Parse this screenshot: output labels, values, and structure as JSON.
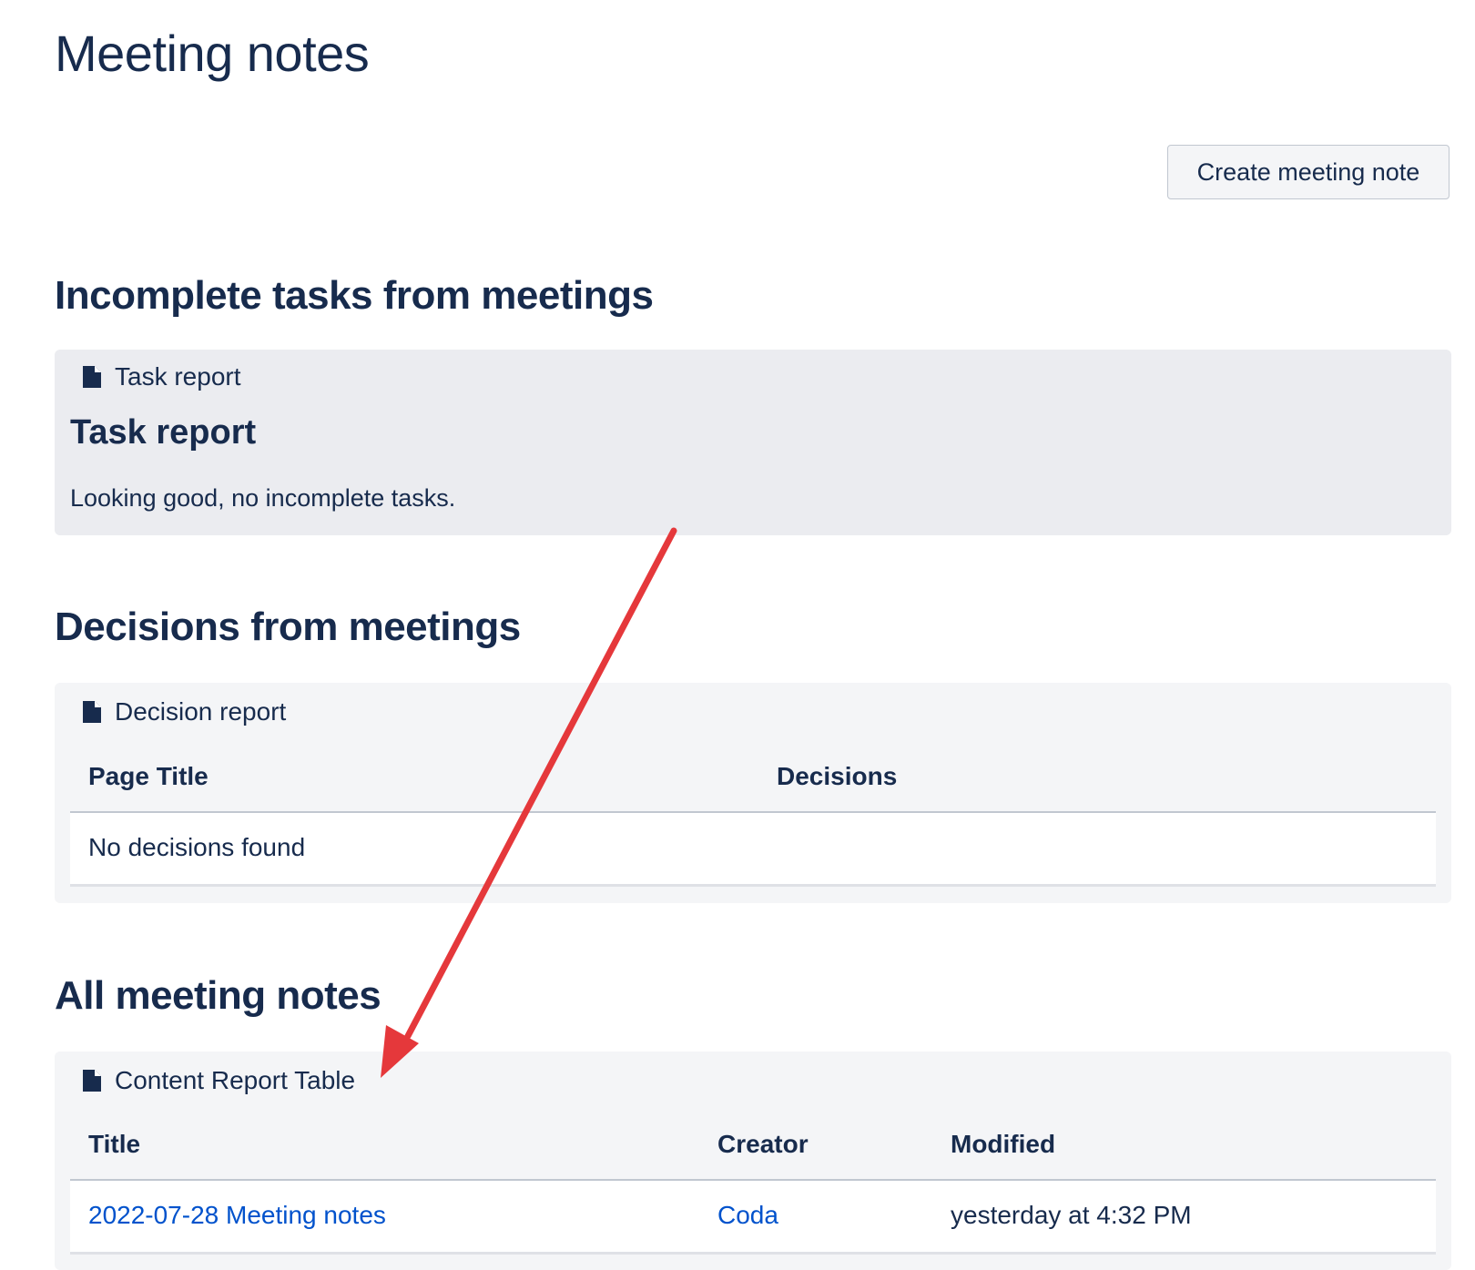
{
  "page": {
    "title": "Meeting notes",
    "create_button_label": "Create meeting note"
  },
  "sections": {
    "tasks": {
      "heading": "Incomplete tasks from meetings",
      "macro_label": "Task report",
      "report_title": "Task report",
      "message": "Looking good, no incomplete tasks."
    },
    "decisions": {
      "heading": "Decisions from meetings",
      "macro_label": "Decision report",
      "columns": [
        "Page Title",
        "Decisions"
      ],
      "empty_message": "No decisions found"
    },
    "all_notes": {
      "heading": "All meeting notes",
      "macro_label": "Content Report Table",
      "columns": [
        "Title",
        "Creator",
        "Modified"
      ],
      "rows": [
        {
          "title": "2022-07-28 Meeting notes",
          "creator": "Coda",
          "modified": "yesterday at 4:32 PM"
        }
      ]
    }
  },
  "annotation": {
    "arrow_color": "#e5383b",
    "icon": "red-arrow-icon"
  },
  "colors": {
    "text": "#172b4d",
    "link": "#0052cc",
    "task_panel_bg": "#ebecf0",
    "panel_bg": "#f4f5f7"
  }
}
